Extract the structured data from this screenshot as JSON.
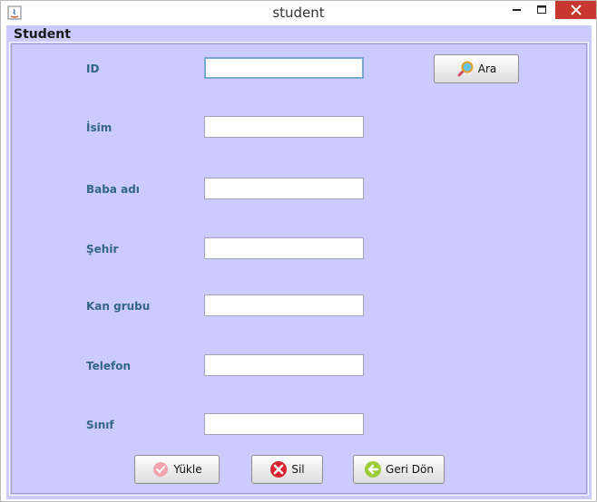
{
  "window": {
    "title": "student",
    "controls": {
      "minimize": "—",
      "maximize": "□",
      "close": "✕"
    },
    "close_color": "#c7372f"
  },
  "panel": {
    "title": "Student",
    "background": "#cccbff"
  },
  "fields": [
    {
      "label": "ID",
      "value": ""
    },
    {
      "label": "İsim",
      "value": ""
    },
    {
      "label": "Baba adı",
      "value": ""
    },
    {
      "label": "Şehir",
      "value": ""
    },
    {
      "label": "Kan grubu",
      "value": ""
    },
    {
      "label": "Telefon",
      "value": ""
    },
    {
      "label": "Sınıf",
      "value": ""
    }
  ],
  "buttons": {
    "search": {
      "label": "Ara",
      "icon": "magnifier-icon"
    },
    "load": {
      "label": "Yükle",
      "icon": "check-icon"
    },
    "delete": {
      "label": "Sil",
      "icon": "delete-x-icon"
    },
    "back": {
      "label": "Geri Dön",
      "icon": "back-arrow-icon"
    }
  },
  "colors": {
    "label_text": "#33658a",
    "accent_focus": "#7aa8d6"
  }
}
